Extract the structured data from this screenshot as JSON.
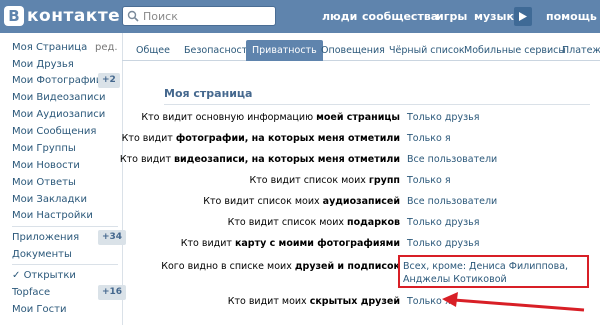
{
  "header": {
    "logo_mark": "В",
    "logo_text": "контакте",
    "search_placeholder": "Поиск",
    "nav": [
      "люди",
      "сообщества",
      "игры",
      "музыка",
      "помощь"
    ]
  },
  "sidebar": {
    "items": [
      {
        "label": "Моя Страница",
        "extra": "ред."
      },
      {
        "label": "Мои Друзья"
      },
      {
        "label": "Мои Фотографии",
        "badge": "+2"
      },
      {
        "label": "Мои Видеозаписи"
      },
      {
        "label": "Мои Аудиозаписи"
      },
      {
        "label": "Мои Сообщения"
      },
      {
        "label": "Мои Группы"
      },
      {
        "label": "Мои Новости"
      },
      {
        "label": "Мои Ответы"
      },
      {
        "label": "Мои Закладки"
      },
      {
        "label": "Мои Настройки"
      }
    ],
    "apps": [
      {
        "label": "Приложения",
        "badge": "+34"
      },
      {
        "label": "Документы"
      }
    ],
    "games": [
      {
        "label": "Открытки"
      },
      {
        "label": "Topface",
        "badge": "+16"
      },
      {
        "label": "Мои Гости"
      }
    ]
  },
  "tabs": [
    "Общее",
    "Безопасность",
    "Приватность",
    "Оповещения",
    "Чёрный список",
    "Мобильные сервисы",
    "Платежи"
  ],
  "active_tab": "Приватность",
  "section": {
    "title": "Моя страница",
    "rows": [
      {
        "prefix": "Кто видит основную информацию ",
        "bold": "моей страницы",
        "value": "Только друзья"
      },
      {
        "prefix": "Кто видит ",
        "bold": "фотографии, на которых меня отметили",
        "value": "Только я"
      },
      {
        "prefix": "Кто видит ",
        "bold": "видеозаписи, на которых меня отметили",
        "value": "Все пользователи"
      },
      {
        "prefix": "Кто видит список моих ",
        "bold": "групп",
        "value": "Только я"
      },
      {
        "prefix": "Кто видит список моих ",
        "bold": "аудиозаписей",
        "value": "Все пользователи"
      },
      {
        "prefix": "Кто видит список моих ",
        "bold": "подарков",
        "value": "Только друзья"
      },
      {
        "prefix": "Кто видит ",
        "bold": "карту с моими фотографиями",
        "value": "Только друзья"
      },
      {
        "prefix": "Кого видно в списке моих ",
        "bold": "друзей и подписок",
        "value": "Всех, кроме: Дениса Филиппова, Анджелы Котиковой"
      },
      {
        "prefix": "Кто видит моих ",
        "bold": "скрытых друзей",
        "value": "Только я"
      }
    ]
  },
  "colors": {
    "brand": "#5f84ad",
    "link": "#2b587a",
    "highlight": "#d81f26"
  }
}
